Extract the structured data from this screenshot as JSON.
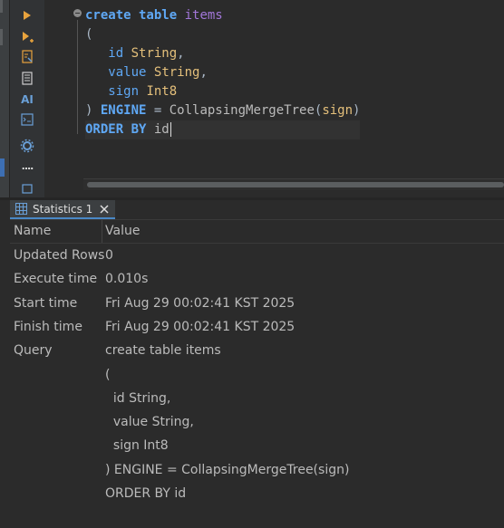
{
  "editor": {
    "lines": [
      [
        {
          "t": "create table",
          "c": "kw"
        },
        {
          "t": " "
        },
        {
          "t": "items",
          "c": "ident"
        }
      ],
      [
        {
          "t": "("
        }
      ],
      [
        {
          "t": "   "
        },
        {
          "t": "id",
          "c": "fld"
        },
        {
          "t": " "
        },
        {
          "t": "String",
          "c": "typ"
        },
        {
          "t": ","
        }
      ],
      [
        {
          "t": "   "
        },
        {
          "t": "value",
          "c": "fld"
        },
        {
          "t": " "
        },
        {
          "t": "String",
          "c": "typ"
        },
        {
          "t": ","
        }
      ],
      [
        {
          "t": "   "
        },
        {
          "t": "sign",
          "c": "fld"
        },
        {
          "t": " "
        },
        {
          "t": "Int8",
          "c": "typ"
        }
      ],
      [
        {
          "t": ") "
        },
        {
          "t": "ENGINE",
          "c": "kw"
        },
        {
          "t": " = "
        },
        {
          "t": "CollapsingMergeTree",
          "c": "plain"
        },
        {
          "t": "("
        },
        {
          "t": "sign",
          "c": "gold"
        },
        {
          "t": ")"
        }
      ],
      [
        {
          "t": "ORDER BY",
          "c": "kw"
        },
        {
          "t": " "
        },
        {
          "t": "id",
          "c": "plain"
        }
      ]
    ]
  },
  "toolbar": {
    "icons": [
      "execute-icon",
      "execute-script-icon",
      "explain-plan-icon",
      "load-script-icon",
      "ai-icon",
      "console-icon",
      "settings-icon",
      "more-icon",
      "export-icon"
    ],
    "ai_label": "AI",
    "more_label": "...."
  },
  "results": {
    "tab_label": "Statistics 1",
    "columns": {
      "name": "Name",
      "value": "Value"
    },
    "rows": [
      {
        "name": "Updated Rows",
        "value": "0"
      },
      {
        "name": "Execute time",
        "value": "0.010s"
      },
      {
        "name": "Start time",
        "value": "Fri Aug 29 00:02:41 KST 2025"
      },
      {
        "name": "Finish time",
        "value": "Fri Aug 29 00:02:41 KST 2025"
      },
      {
        "name": "Query",
        "value": "create table items"
      },
      {
        "name": "",
        "value": "("
      },
      {
        "name": "",
        "value": "  id String,"
      },
      {
        "name": "",
        "value": "  value String,"
      },
      {
        "name": "",
        "value": "  sign Int8"
      },
      {
        "name": "",
        "value": ") ENGINE = CollapsingMergeTree(sign)"
      },
      {
        "name": "",
        "value": "ORDER BY id"
      }
    ]
  },
  "colors": {
    "accent": "#4a88c7",
    "run": "#e8a33d",
    "keyword": "#5fa8f5",
    "type": "#e5c07b",
    "ident": "#a277d9"
  }
}
